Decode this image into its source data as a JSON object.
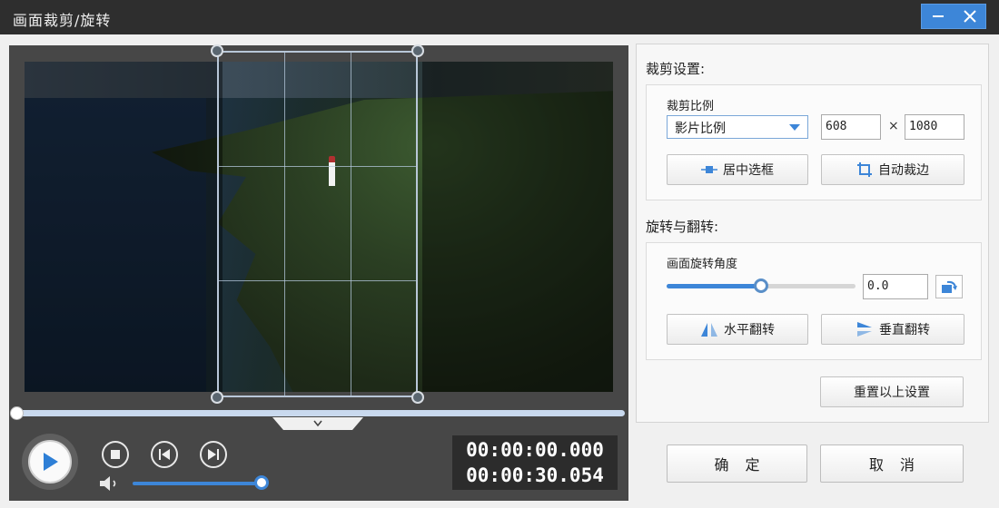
{
  "window": {
    "title": "画面裁剪/旋转",
    "minimize_icon": "minimize-icon",
    "close_icon": "close-icon"
  },
  "player": {
    "play_icon": "play-icon",
    "stop_icon": "stop-icon",
    "prev_icon": "previous-icon",
    "next_icon": "next-icon",
    "volume_icon": "volume-icon",
    "current_time": "00:00:00.000",
    "total_time": "00:00:30.054",
    "progress": 0.0,
    "volume": 0.95
  },
  "crop": {
    "section_title": "裁剪设置:",
    "ratio_label": "裁剪比例",
    "ratio_value": "影片比例",
    "width": "608",
    "times": "×",
    "height": "1080",
    "center_button": "居中选框",
    "auto_button": "自动裁边"
  },
  "rotate": {
    "section_title": "旋转与翻转:",
    "angle_label": "画面旋转角度",
    "angle_value": "0.0",
    "angle_slider": 0.5,
    "hflip_button": "水平翻转",
    "vflip_button": "垂直翻转"
  },
  "actions": {
    "reset": "重置以上设置",
    "ok": "确定",
    "cancel": "取消"
  },
  "colors": {
    "accent": "#3d86d8",
    "titlebar": "#2e2e2e",
    "panel": "#f0f0f0"
  }
}
